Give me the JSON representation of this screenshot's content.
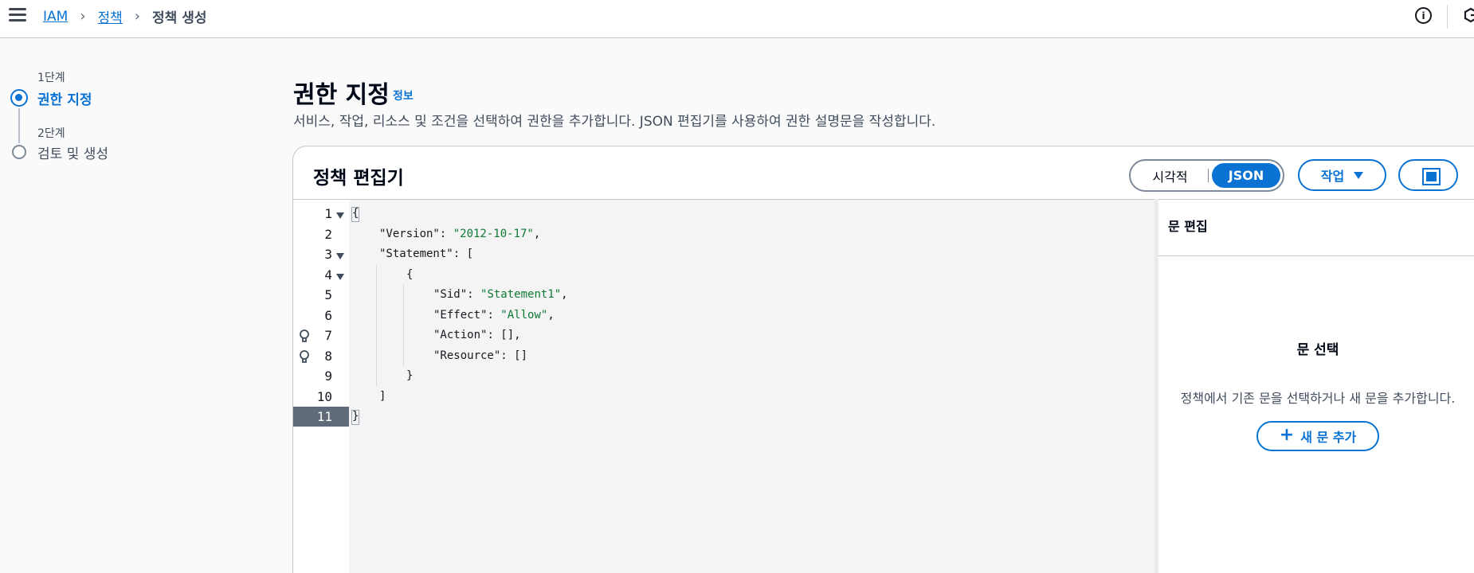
{
  "breadcrumb": {
    "items": [
      "IAM",
      "정책"
    ],
    "current": "정책 생성"
  },
  "header_icons": {
    "info": "i"
  },
  "steps": [
    {
      "number": "1단계",
      "title": "권한 지정",
      "state": "active"
    },
    {
      "number": "2단계",
      "title": "검토 및 생성",
      "state": "inactive"
    }
  ],
  "page": {
    "title": "권한 지정",
    "info_link": "정보",
    "description": "서비스, 작업, 리소스 및 조건을 선택하여 권한을 추가합니다. JSON 편집기를 사용하여 권한 설명문을 작성합니다."
  },
  "editor": {
    "title": "정책 편집기",
    "mode_visual": "시각적",
    "mode_json": "JSON",
    "selected_mode": "JSON",
    "actions_label": "작업",
    "active_line": 11,
    "lines": [
      {
        "no": "1",
        "fold": true,
        "bulb": false,
        "indent": 0,
        "tokens": [
          {
            "t": "p",
            "v": "{"
          }
        ]
      },
      {
        "no": "2",
        "fold": false,
        "bulb": false,
        "indent": 1,
        "tokens": [
          {
            "t": "k",
            "v": "\"Version\""
          },
          {
            "t": "p",
            "v": ": "
          },
          {
            "t": "s",
            "v": "\"2012-10-17\""
          },
          {
            "t": "p",
            "v": ","
          }
        ]
      },
      {
        "no": "3",
        "fold": true,
        "bulb": false,
        "indent": 1,
        "tokens": [
          {
            "t": "k",
            "v": "\"Statement\""
          },
          {
            "t": "p",
            "v": ": ["
          }
        ]
      },
      {
        "no": "4",
        "fold": true,
        "bulb": false,
        "indent": 2,
        "tokens": [
          {
            "t": "p",
            "v": "{"
          }
        ]
      },
      {
        "no": "5",
        "fold": false,
        "bulb": false,
        "indent": 3,
        "tokens": [
          {
            "t": "k",
            "v": "\"Sid\""
          },
          {
            "t": "p",
            "v": ": "
          },
          {
            "t": "s",
            "v": "\"Statement1\""
          },
          {
            "t": "p",
            "v": ","
          }
        ]
      },
      {
        "no": "6",
        "fold": false,
        "bulb": false,
        "indent": 3,
        "tokens": [
          {
            "t": "k",
            "v": "\"Effect\""
          },
          {
            "t": "p",
            "v": ": "
          },
          {
            "t": "s",
            "v": "\"Allow\""
          },
          {
            "t": "p",
            "v": ","
          }
        ]
      },
      {
        "no": "7",
        "fold": false,
        "bulb": true,
        "indent": 3,
        "tokens": [
          {
            "t": "k",
            "v": "\"Action\""
          },
          {
            "t": "p",
            "v": ": [],"
          }
        ]
      },
      {
        "no": "8",
        "fold": false,
        "bulb": true,
        "indent": 3,
        "tokens": [
          {
            "t": "k",
            "v": "\"Resource\""
          },
          {
            "t": "p",
            "v": ": []"
          }
        ]
      },
      {
        "no": "9",
        "fold": false,
        "bulb": false,
        "indent": 2,
        "tokens": [
          {
            "t": "p",
            "v": "}"
          }
        ]
      },
      {
        "no": "10",
        "fold": false,
        "bulb": false,
        "indent": 1,
        "tokens": [
          {
            "t": "p",
            "v": "]"
          }
        ]
      },
      {
        "no": "11",
        "fold": false,
        "bulb": false,
        "indent": 0,
        "tokens": [
          {
            "t": "p",
            "v": "}"
          }
        ]
      }
    ]
  },
  "statement_panel": {
    "title": "문 편집",
    "empty_title": "문 선택",
    "empty_desc": "정책에서 기존 문을 선택하거나 새 문을 추가합니다.",
    "add_button": "새 문 추가"
  },
  "colors": {
    "accent": "#0972d3",
    "string": "#0d7a35",
    "active_line_gutter": "#5f6b7a"
  }
}
